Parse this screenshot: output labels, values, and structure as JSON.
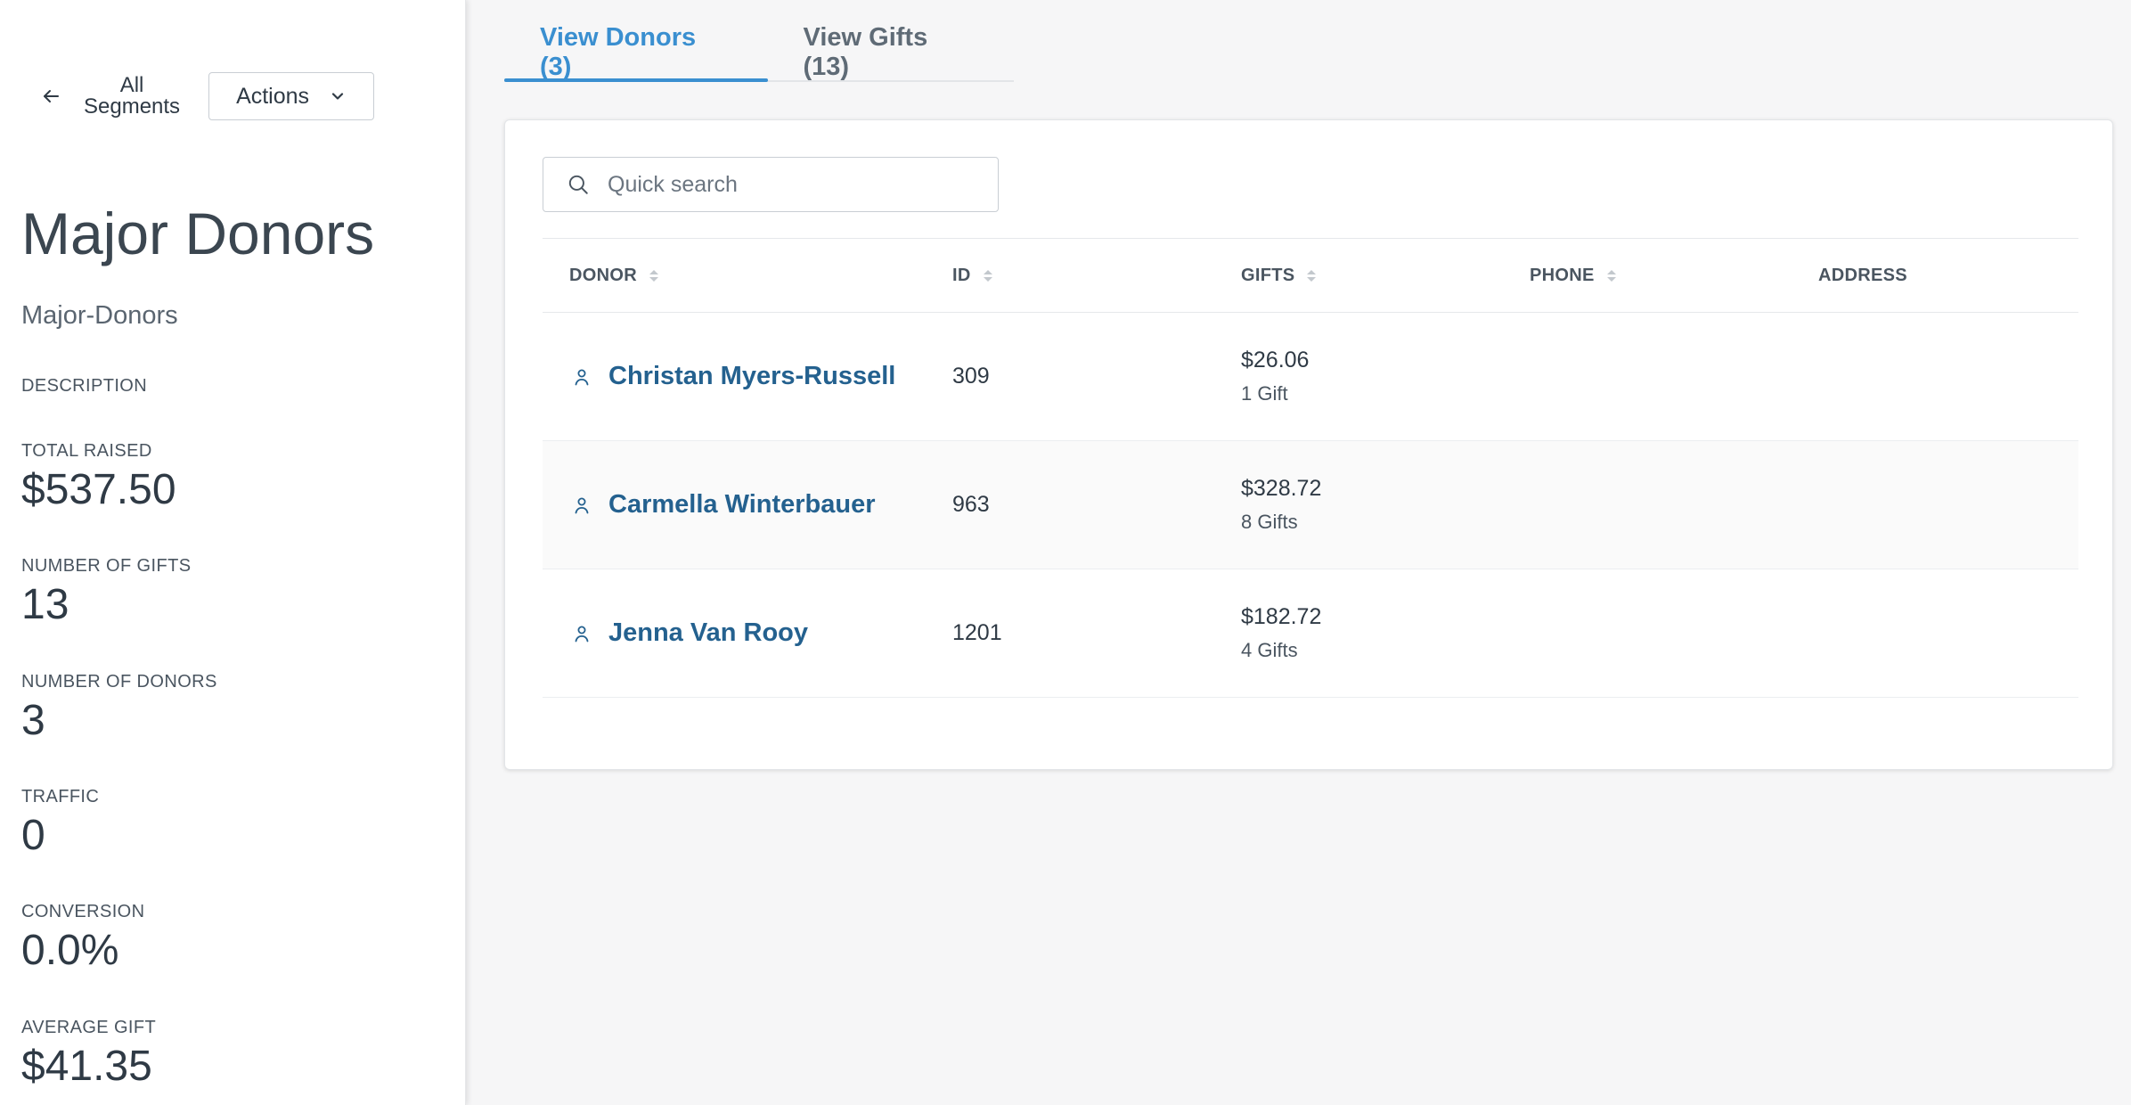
{
  "sidebar": {
    "back_line1": "All",
    "back_line2": "Segments",
    "actions_label": "Actions",
    "title": "Major Donors",
    "slug": "Major-Donors",
    "description_label": "DESCRIPTION",
    "stats": {
      "total_raised_label": "TOTAL RAISED",
      "total_raised_value": "$537.50",
      "number_of_gifts_label": "NUMBER OF GIFTS",
      "number_of_gifts_value": "13",
      "number_of_donors_label": "NUMBER OF DONORS",
      "number_of_donors_value": "3",
      "traffic_label": "TRAFFIC",
      "traffic_value": "0",
      "conversion_label": "CONVERSION",
      "conversion_value": "0.0%",
      "average_gift_label": "AVERAGE GIFT",
      "average_gift_value": "$41.35"
    }
  },
  "tabs": {
    "donors": "View Donors (3)",
    "gifts": "View Gifts (13)"
  },
  "search": {
    "placeholder": "Quick search",
    "value": ""
  },
  "table": {
    "headers": {
      "donor": "DONOR",
      "id": "ID",
      "gifts": "GIFTS",
      "phone": "PHONE",
      "address": "ADDRESS"
    },
    "rows": [
      {
        "name": "Christan Myers-Russell",
        "id": "309",
        "gift_amount": "$26.06",
        "gift_count": "1 Gift",
        "phone": "",
        "address": ""
      },
      {
        "name": "Carmella Winterbauer",
        "id": "963",
        "gift_amount": "$328.72",
        "gift_count": "8 Gifts",
        "phone": "",
        "address": ""
      },
      {
        "name": "Jenna Van Rooy",
        "id": "1201",
        "gift_amount": "$182.72",
        "gift_count": "4 Gifts",
        "phone": "",
        "address": ""
      }
    ]
  },
  "colors": {
    "accent": "#3a8fd0",
    "link": "#24618f"
  },
  "icons": {
    "back": "arrow-left-icon",
    "actions": "chevron-down-icon",
    "search": "search-icon",
    "donor": "person-icon",
    "sort": "sort-icon"
  }
}
